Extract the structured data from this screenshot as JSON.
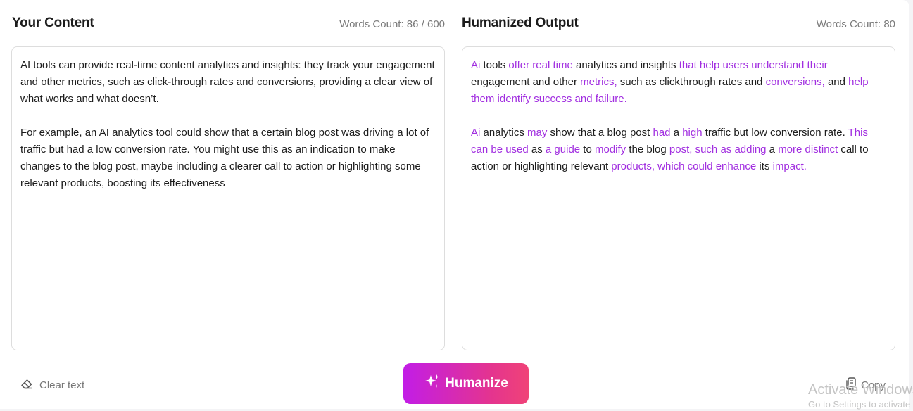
{
  "left_panel": {
    "title": "Your Content",
    "word_count": "Words Count: 86 / 600",
    "paragraphs": [
      "AI tools can provide real-time content analytics and insights: they track your engagement and other metrics, such as click-through rates and conversions, providing a clear view of what works and what doesn’t.",
      "For example, an AI analytics tool could show that a certain blog post was driving a lot of traffic but had a low conversion rate. You might use this as an indication to make changes to the blog post, maybe including a clearer call to action or highlighting some relevant products, boosting its effectiveness"
    ]
  },
  "right_panel": {
    "title": "Humanized Output",
    "word_count": "Words Count: 80",
    "paragraphs": [
      [
        {
          "text": "Ai",
          "changed": true
        },
        {
          "text": " tools ",
          "changed": false
        },
        {
          "text": "offer real time",
          "changed": true
        },
        {
          "text": " analytics and insights ",
          "changed": false
        },
        {
          "text": "that help users understand their",
          "changed": true
        },
        {
          "text": " engagement and other ",
          "changed": false
        },
        {
          "text": "metrics,",
          "changed": true
        },
        {
          "text": " such as clickthrough rates and ",
          "changed": false
        },
        {
          "text": "conversions,",
          "changed": true
        },
        {
          "text": " and ",
          "changed": false
        },
        {
          "text": "help them identify success and failure.",
          "changed": true
        }
      ],
      [
        {
          "text": "Ai",
          "changed": true
        },
        {
          "text": " analytics ",
          "changed": false
        },
        {
          "text": "may",
          "changed": true
        },
        {
          "text": " show that a blog post ",
          "changed": false
        },
        {
          "text": "had",
          "changed": true
        },
        {
          "text": " a ",
          "changed": false
        },
        {
          "text": "high",
          "changed": true
        },
        {
          "text": " traffic but low conversion rate. ",
          "changed": false
        },
        {
          "text": "This can be used",
          "changed": true
        },
        {
          "text": " as ",
          "changed": false
        },
        {
          "text": "a guide",
          "changed": true
        },
        {
          "text": " to ",
          "changed": false
        },
        {
          "text": "modify",
          "changed": true
        },
        {
          "text": " the blog ",
          "changed": false
        },
        {
          "text": "post, such as adding",
          "changed": true
        },
        {
          "text": " a ",
          "changed": false
        },
        {
          "text": "more distinct",
          "changed": true
        },
        {
          "text": " call to action or highlighting relevant ",
          "changed": false
        },
        {
          "text": "products, which could enhance",
          "changed": true
        },
        {
          "text": " its ",
          "changed": false
        },
        {
          "text": "impact.",
          "changed": true
        }
      ]
    ]
  },
  "actions": {
    "clear_label": "Clear text",
    "humanize_label": "Humanize",
    "copy_label": "Copy"
  },
  "watermark": {
    "line1": "Activate Windows",
    "line2": "Go to Settings to activate Windows."
  },
  "icons": {
    "clear": "eraser-icon",
    "humanize": "sparkles-icon",
    "copy": "copy-icon"
  },
  "colors": {
    "highlight": "#a12ee0",
    "button_gradient_start": "#c21de6",
    "button_gradient_end": "#f04377"
  }
}
